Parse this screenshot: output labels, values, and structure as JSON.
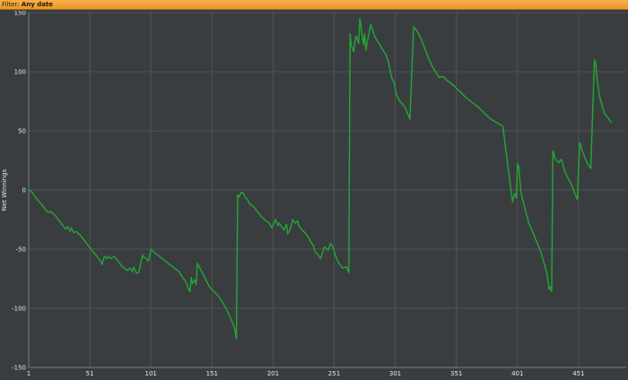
{
  "filter": {
    "label": "Filter:",
    "value": "Any date"
  },
  "colors": {
    "background": "#3a3d40",
    "grid": "#4f5357",
    "line": "#22a832",
    "text": "#e6e6e6"
  },
  "chart_data": {
    "type": "line",
    "title": "",
    "xlabel": "",
    "ylabel": "Net Winnings",
    "xlim": [
      1,
      490
    ],
    "ylim": [
      -150,
      150
    ],
    "xticks": [
      1,
      51,
      101,
      151,
      201,
      251,
      301,
      351,
      401,
      451
    ],
    "yticks": [
      -150,
      -100,
      -50,
      0,
      50,
      100,
      150
    ],
    "grid": true,
    "legend": "none",
    "series": [
      {
        "values_x": [
          1,
          3,
          8,
          13,
          15,
          17,
          19,
          21,
          23,
          26,
          29,
          31,
          33,
          35,
          36,
          38,
          40,
          43,
          46,
          49,
          52,
          55,
          57,
          58,
          60,
          61,
          63,
          65,
          66,
          68,
          71,
          74,
          77,
          80,
          82,
          84,
          86,
          87,
          89,
          91,
          94,
          95,
          96,
          99,
          101,
          104,
          109,
          114,
          119,
          124,
          127,
          130,
          131,
          133,
          134,
          135,
          137,
          138,
          139,
          141,
          144,
          147,
          149,
          153,
          158,
          163,
          166,
          169,
          170,
          171,
          172,
          173,
          175,
          177,
          178,
          180,
          182,
          185,
          188,
          191,
          195,
          198,
          200,
          203,
          205,
          206,
          208,
          210,
          212,
          213,
          215,
          217,
          219,
          221,
          222,
          224,
          227,
          230,
          232,
          234,
          235,
          236,
          238,
          240,
          243,
          246,
          248,
          250,
          251,
          252,
          253,
          255,
          258,
          261,
          263,
          264,
          265,
          267,
          268,
          269,
          271,
          272,
          274,
          275,
          276,
          277,
          278,
          281,
          284,
          287,
          290,
          293,
          295,
          296,
          297,
          298,
          300,
          302,
          305,
          309,
          313,
          316,
          319,
          322,
          325,
          328,
          331,
          334,
          337,
          340,
          343,
          349,
          359,
          369,
          379,
          389,
          397,
          398,
          399,
          400,
          401,
          402,
          404,
          410,
          420,
          425,
          427,
          428,
          429,
          430,
          431,
          432,
          435,
          436,
          437,
          438,
          440,
          445,
          450,
          452,
          453,
          454,
          456,
          458,
          461,
          464,
          465,
          466,
          468,
          472,
          478,
          482,
          486,
          490
        ],
        "values_y": [
          0,
          -1,
          -8,
          -14,
          -17,
          -19,
          -18,
          -20,
          -22,
          -26,
          -30,
          -33,
          -31,
          -35,
          -32,
          -36,
          -35,
          -38,
          -42,
          -46,
          -50,
          -54,
          -56,
          -58,
          -60,
          -63,
          -56,
          -58,
          -56,
          -58,
          -56,
          -60,
          -64,
          -67,
          -68,
          -66,
          -69,
          -65,
          -70,
          -70,
          -55,
          -57,
          -57,
          -60,
          -50,
          -53,
          -57,
          -61,
          -65,
          -69,
          -74,
          -78,
          -82,
          -86,
          -74,
          -79,
          -76,
          -80,
          -62,
          -66,
          -72,
          -78,
          -82,
          -86,
          -92,
          -101,
          -108,
          -115,
          -120,
          -126,
          -4,
          -6,
          -2,
          -3,
          -6,
          -8,
          -12,
          -14,
          -18,
          -22,
          -26,
          -28,
          -32,
          -25,
          -30,
          -28,
          -31,
          -34,
          -29,
          -37,
          -33,
          -25,
          -28,
          -26,
          -30,
          -33,
          -36,
          -40,
          -44,
          -47,
          -51,
          -53,
          -55,
          -58,
          -48,
          -51,
          -45,
          -48,
          -52,
          -55,
          -58,
          -62,
          -66,
          -65,
          -70,
          132,
          122,
          117,
          126,
          130,
          124,
          145,
          130,
          123,
          132,
          118,
          125,
          140,
          130,
          125,
          120,
          115,
          110,
          105,
          100,
          95,
          91,
          80,
          75,
          70,
          60,
          138,
          134,
          128,
          120,
          112,
          105,
          100,
          95,
          96,
          93,
          88,
          78,
          70,
          60,
          54,
          -10,
          -5,
          -3,
          -7,
          22,
          20,
          -3,
          -27,
          -52,
          -70,
          -84,
          -82,
          -86,
          33,
          30,
          26,
          23,
          25,
          26,
          22,
          15,
          5,
          -8,
          40,
          37,
          33,
          28,
          23,
          18,
          110,
          107,
          95,
          80,
          65,
          57
        ]
      }
    ]
  }
}
